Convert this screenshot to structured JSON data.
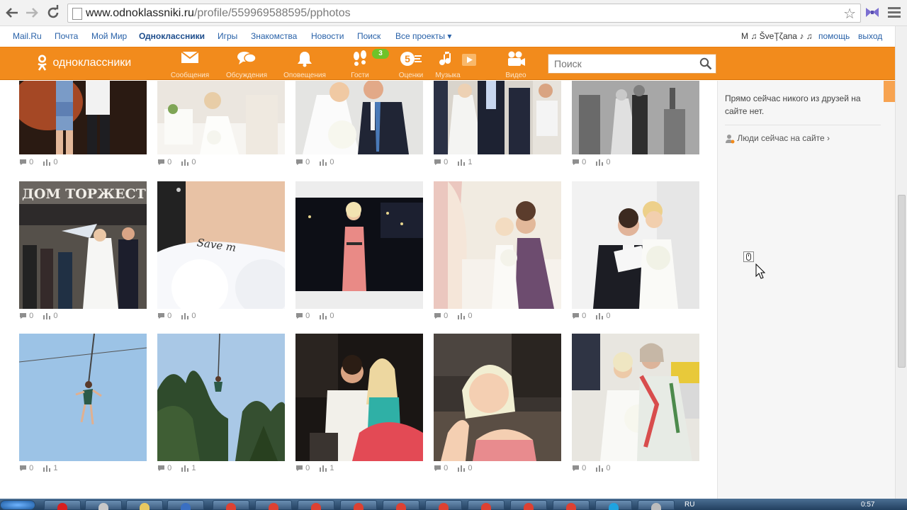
{
  "browser": {
    "url_host": "www.odnoklassniki.ru",
    "url_path": "/profile/559969588595/pphotos",
    "back_icon": "back-arrow-icon",
    "forward_icon": "forward-arrow-icon",
    "reload_icon": "reload-icon",
    "bookmark_icon": "star-icon"
  },
  "portal": {
    "links": [
      "Mail.Ru",
      "Почта",
      "Мой Мир",
      "Одноклассники",
      "Игры",
      "Знакомства",
      "Новости",
      "Поиск",
      "Все проекты ▾"
    ],
    "user": "M ♫ ŠveŢζana ♪ ♫",
    "help": "помощь",
    "logout": "выход"
  },
  "header": {
    "logo_text": "одноклассники",
    "nav": [
      {
        "label": "Сообщения",
        "icon": "envelope-icon"
      },
      {
        "label": "Обсуждения",
        "icon": "chat-bubbles-icon"
      },
      {
        "label": "Оповещения",
        "icon": "bell-icon"
      },
      {
        "label": "Гости",
        "icon": "footprints-icon"
      },
      {
        "label": "Оценки",
        "icon": "rating-5-icon"
      },
      {
        "label": "Музыка",
        "icon": "music-note-icon"
      },
      {
        "label": "Видео",
        "icon": "video-camera-icon"
      }
    ],
    "guests_badge": "3",
    "search_placeholder": "Поиск",
    "brand_color": "#f28b1c"
  },
  "photos": {
    "rows": [
      [
        {
          "comments": "0",
          "rating": "0"
        },
        {
          "comments": "0",
          "rating": "0"
        },
        {
          "comments": "0",
          "rating": "0"
        },
        {
          "comments": "0",
          "rating": "1"
        },
        {
          "comments": "0",
          "rating": "0"
        }
      ],
      [
        {
          "comments": "0",
          "rating": "0"
        },
        {
          "comments": "0",
          "rating": "0"
        },
        {
          "comments": "0",
          "rating": "0"
        },
        {
          "comments": "0",
          "rating": "0"
        },
        {
          "comments": "0",
          "rating": "0"
        }
      ],
      [
        {
          "comments": "0",
          "rating": "1"
        },
        {
          "comments": "0",
          "rating": "1"
        },
        {
          "comments": "0",
          "rating": "1"
        },
        {
          "comments": "0",
          "rating": "0"
        },
        {
          "comments": "0",
          "rating": "0"
        }
      ]
    ],
    "banner_text": "ДОМ ТОРЖЕСТ",
    "tattoo_text": "Save m"
  },
  "sidebar": {
    "online_message": "Прямо сейчас никого из друзей на сайте нет.",
    "people_link": "Люди сейчас на сайте ›"
  },
  "taskbar": {
    "lang": "RU",
    "time": "0:57"
  }
}
